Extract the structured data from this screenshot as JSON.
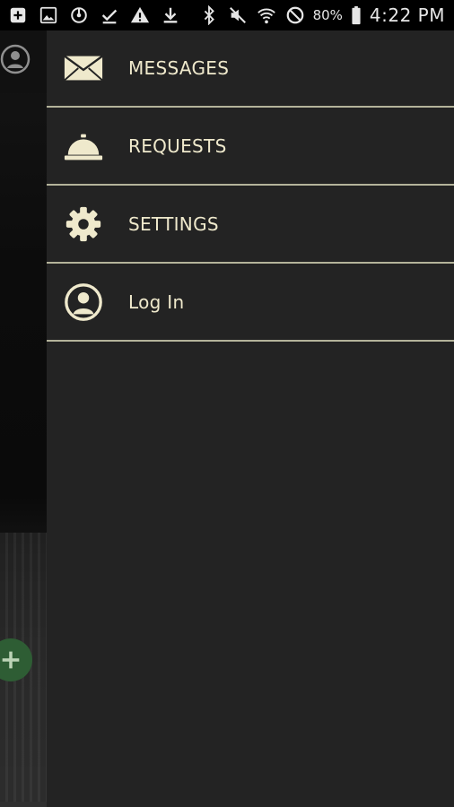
{
  "status_bar": {
    "left_icons": [
      "add-box-icon",
      "image-icon",
      "sync-icon",
      "check-icon",
      "warning-icon",
      "download-icon"
    ],
    "right_icons": [
      "bluetooth-icon",
      "mute-icon",
      "wifi-icon",
      "do-not-disturb-icon",
      "battery-icon"
    ],
    "battery": "80%",
    "time": "4:22 PM"
  },
  "drawer": {
    "items": [
      {
        "label": "MESSAGES",
        "icon": "envelope-icon"
      },
      {
        "label": "REQUESTS",
        "icon": "service-bell-icon"
      },
      {
        "label": "SETTINGS",
        "icon": "gear-icon"
      },
      {
        "label": "Log In",
        "icon": "user-circle-icon"
      }
    ]
  },
  "colors": {
    "drawer_bg": "#232323",
    "accent": "#efe9cc",
    "divider": "#b4b39a",
    "fab": "#2e5d34"
  }
}
